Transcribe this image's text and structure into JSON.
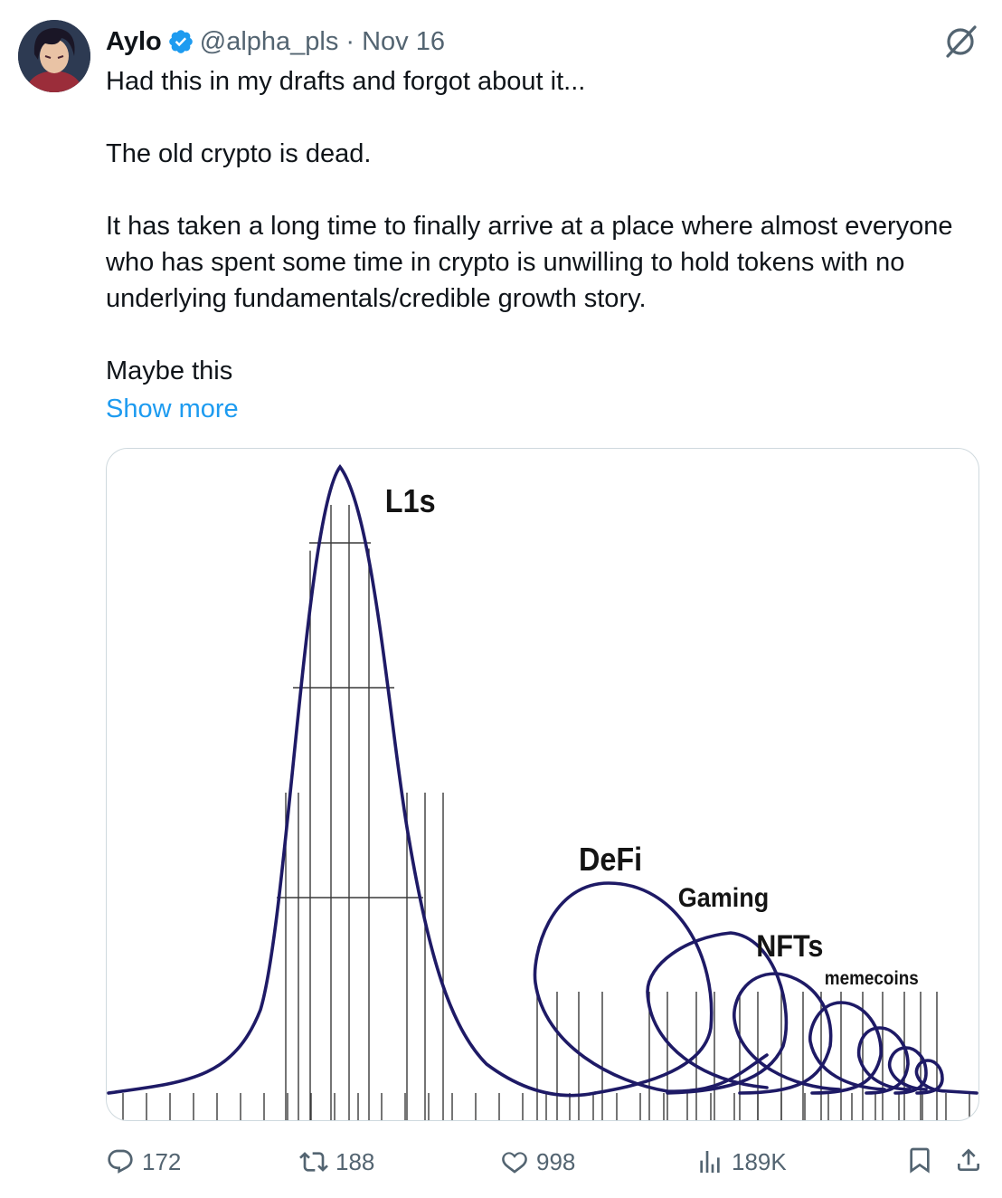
{
  "author": {
    "name": "Aylo",
    "handle": "@alpha_pls",
    "separator": "·",
    "date": "Nov 16"
  },
  "tweet": {
    "paragraphs": [
      "Had this in my drafts and forgot about it...",
      "The old crypto is dead.",
      "It has taken a long time to finally arrive at a place where almost everyone who has spent some time in crypto is unwilling to hold tokens with no underlying fundamentals/credible growth story.",
      "Maybe this"
    ],
    "show_more": "Show more"
  },
  "image": {
    "labels": {
      "l1s": "L1s",
      "defi": "DeFi",
      "gaming": "Gaming",
      "nfts": "NFTs",
      "memecoins": "memecoins"
    }
  },
  "actions": {
    "replies": "172",
    "reposts": "188",
    "likes": "998",
    "views": "189K"
  },
  "colors": {
    "accent": "#1d9bf0",
    "muted": "#536471",
    "coaster": "#1e1a66"
  },
  "icons": [
    "verified-badge-icon",
    "grok-icon",
    "reply-icon",
    "repost-icon",
    "like-icon",
    "views-icon",
    "bookmark-icon",
    "share-icon"
  ]
}
